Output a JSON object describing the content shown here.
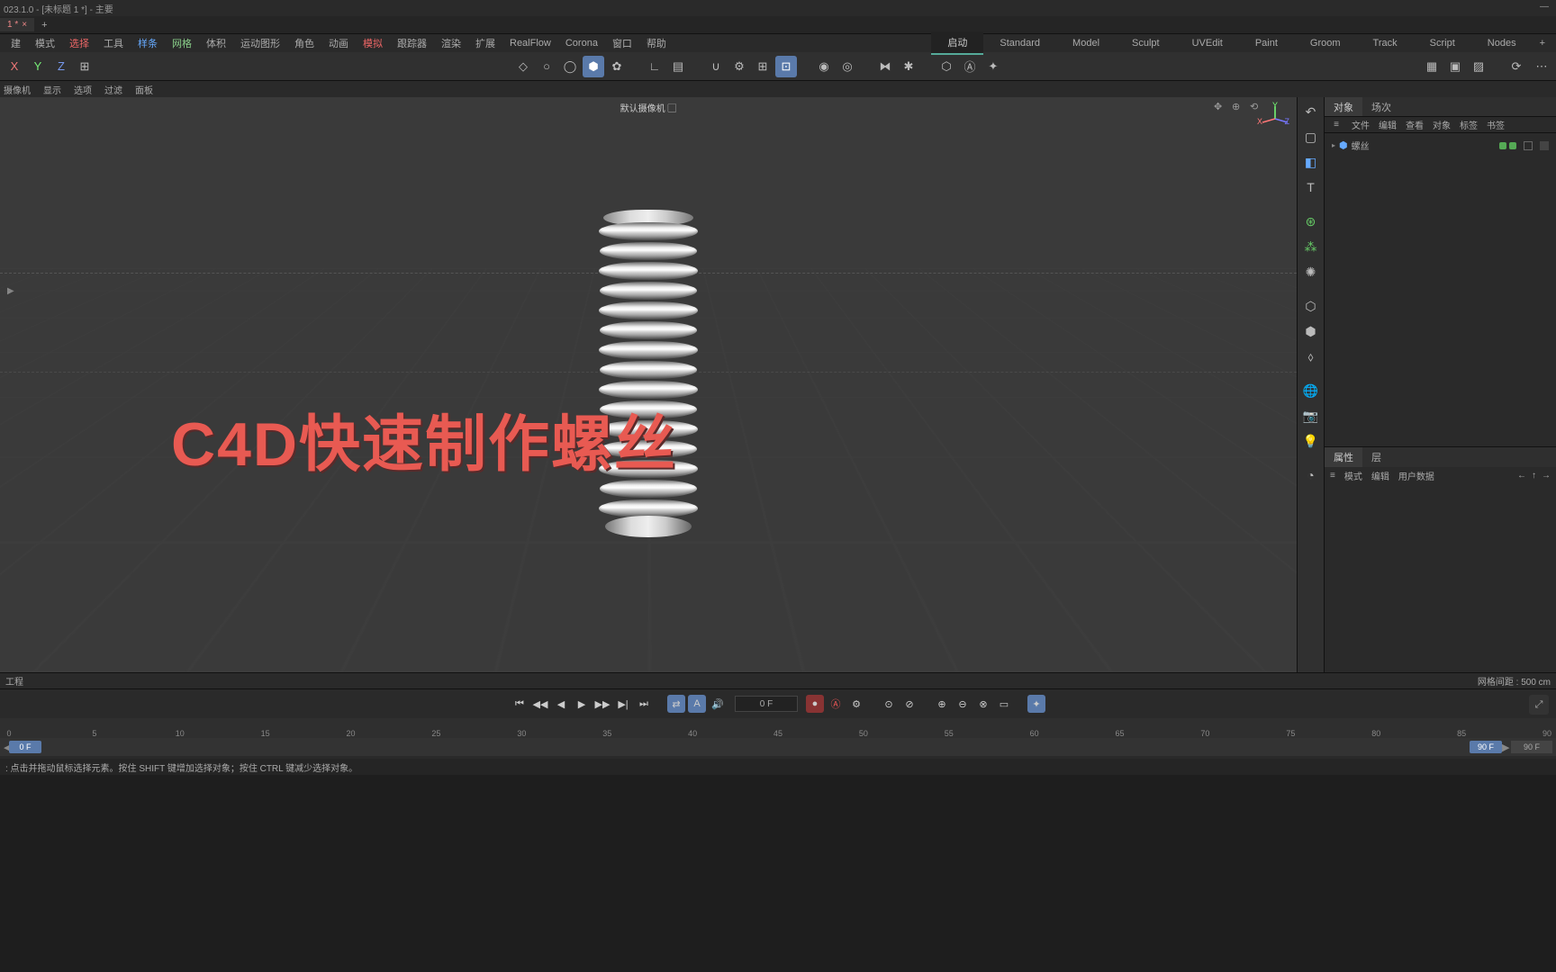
{
  "title_bar": "023.1.0 - [未标题 1 *] - 主要",
  "doc_tab": "1 *",
  "menu": {
    "items": [
      "建",
      "模式",
      "选择",
      "工具",
      "样条",
      "网格",
      "体积",
      "运动图形",
      "角色",
      "动画",
      "模拟",
      "跟踪器",
      "渲染",
      "扩展",
      "RealFlow",
      "Corona",
      "窗口",
      "帮助"
    ],
    "layouts": [
      "启动",
      "Standard",
      "Model",
      "Sculpt",
      "UVEdit",
      "Paint",
      "Groom",
      "Track",
      "Script",
      "Nodes"
    ]
  },
  "sub_bar": [
    "摄像机",
    "显示",
    "选项",
    "过滤",
    "面板"
  ],
  "viewport": {
    "camera": "默认摄像机 ▢",
    "grid_info": "网格间距 : 500 cm",
    "overlay_text": "C4D快速制作螺丝",
    "project_label": "工程"
  },
  "right": {
    "obj_tabs": [
      "对象",
      "场次"
    ],
    "obj_menu": [
      "文件",
      "编辑",
      "查看",
      "对象",
      "标签",
      "书签"
    ],
    "obj_item": "螺丝",
    "attr_tabs": [
      "属性",
      "层"
    ],
    "attr_menu": [
      "模式",
      "编辑",
      "用户数据"
    ]
  },
  "timeline": {
    "frame_value": "0 F",
    "start": "0 F",
    "end": "90 F",
    "end2": "90 F",
    "ticks": [
      0,
      5,
      10,
      15,
      20,
      25,
      30,
      35,
      40,
      45,
      50,
      55,
      60,
      65,
      70,
      75,
      80,
      85,
      90
    ]
  },
  "footer": ": 点击并拖动鼠标选择元素。按住 SHIFT 键增加选择对象；按住 CTRL 键减少选择对象。"
}
